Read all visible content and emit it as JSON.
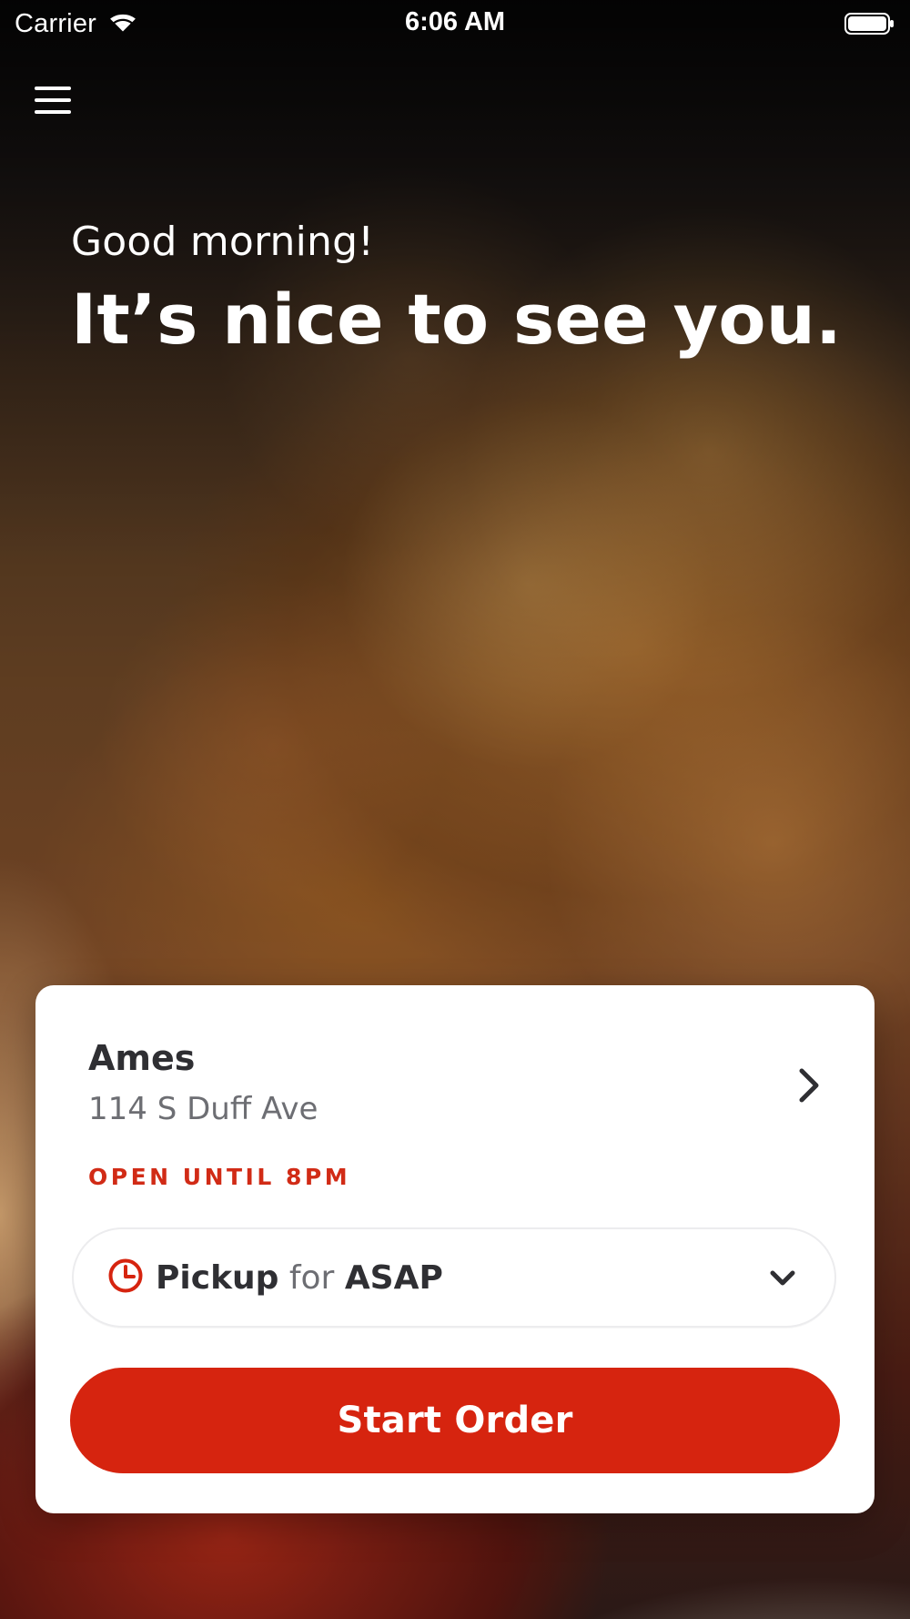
{
  "status_bar": {
    "carrier": "Carrier",
    "time": "6:06 AM"
  },
  "header": {
    "menu_icon": "hamburger-menu-icon"
  },
  "greeting": {
    "subtitle": "Good morning!",
    "headline": "It’s nice to see you."
  },
  "location_card": {
    "name": "Ames",
    "address": "114 S Duff Ave",
    "hours": "OPEN UNTIL 8PM",
    "chevron_icon": "chevron-right-icon",
    "pickup": {
      "icon": "clock-icon",
      "mode": "Pickup",
      "connector": "for",
      "time": "ASAP",
      "chevron_icon": "chevron-down-icon"
    },
    "start_button_label": "Start Order"
  },
  "colors": {
    "accent": "#D6240F",
    "hours_text": "#D12B16",
    "card_background": "#FFFFFF"
  }
}
